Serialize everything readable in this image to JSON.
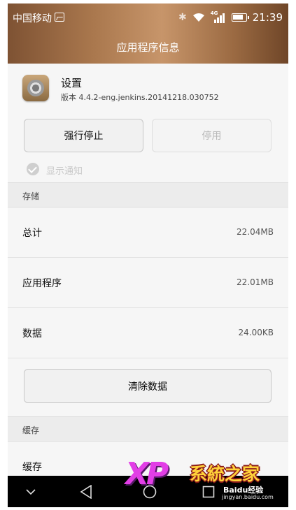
{
  "status_bar": {
    "carrier": "中国移动",
    "network": "4G",
    "time": "21:39"
  },
  "title_bar": {
    "title": "应用程序信息"
  },
  "app": {
    "name": "设置",
    "version": "版本 4.4.2-eng.jenkins.20141218.030752"
  },
  "buttons": {
    "force_stop": "强行停止",
    "disable": "停用",
    "clear_data": "清除数据"
  },
  "notification": {
    "label": "显示通知",
    "checked": true
  },
  "storage": {
    "header": "存储",
    "rows": [
      {
        "label": "总计",
        "value": "22.04MB"
      },
      {
        "label": "应用程序",
        "value": "22.01MB"
      },
      {
        "label": "数据",
        "value": "24.00KB"
      }
    ]
  },
  "cache": {
    "header": "缓存",
    "rows": [
      {
        "label": "缓存"
      }
    ]
  },
  "watermark": {
    "brand_latin": "XP",
    "brand_cn": "系統之家",
    "site": "Baidu经验",
    "url": "jingyan.baidu.com"
  },
  "colors": {
    "title_bar_gradient": [
      "#7e5233",
      "#c7956a",
      "#6f4628"
    ],
    "background": "#f6f6f6",
    "section_bg": "#ececec"
  }
}
